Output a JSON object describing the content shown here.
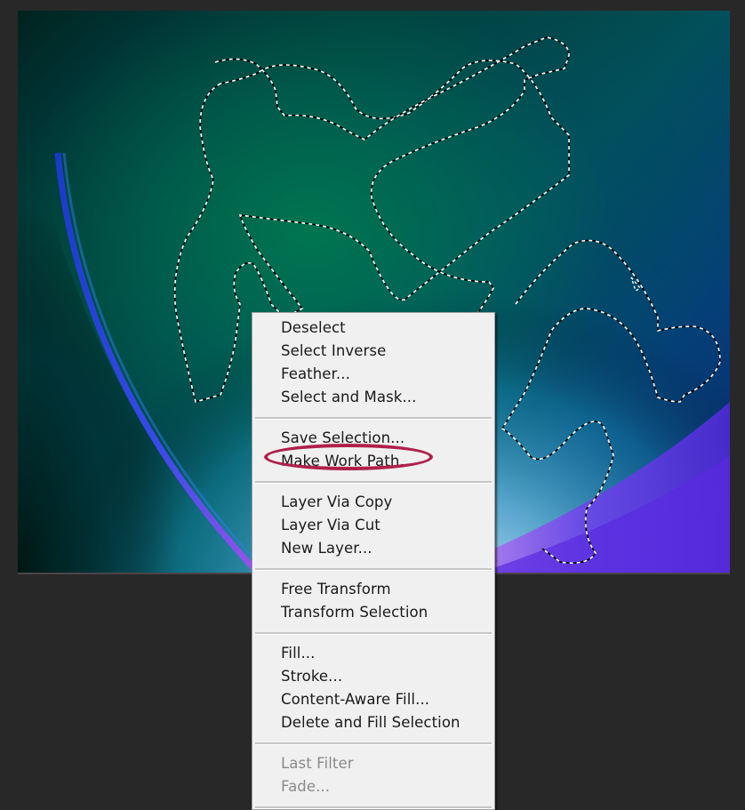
{
  "canvas": {
    "description": "Photo canvas with green-blue glowing planet edge and marching-ants selection around two figure silhouettes",
    "selection_active": true
  },
  "context_menu": {
    "groups": [
      {
        "items": [
          {
            "label": "Deselect",
            "enabled": true
          },
          {
            "label": "Select Inverse",
            "enabled": true
          },
          {
            "label": "Feather...",
            "enabled": true
          },
          {
            "label": "Select and Mask...",
            "enabled": true
          }
        ]
      },
      {
        "items": [
          {
            "label": "Save Selection...",
            "enabled": true
          },
          {
            "label": "Make Work Path...",
            "enabled": true,
            "highlighted": true
          }
        ]
      },
      {
        "items": [
          {
            "label": "Layer Via Copy",
            "enabled": true
          },
          {
            "label": "Layer Via Cut",
            "enabled": true
          },
          {
            "label": "New Layer...",
            "enabled": true
          }
        ]
      },
      {
        "items": [
          {
            "label": "Free Transform",
            "enabled": true
          },
          {
            "label": "Transform Selection",
            "enabled": true
          }
        ]
      },
      {
        "items": [
          {
            "label": "Fill...",
            "enabled": true
          },
          {
            "label": "Stroke...",
            "enabled": true
          },
          {
            "label": "Content-Aware Fill...",
            "enabled": true
          },
          {
            "label": "Delete and Fill Selection",
            "enabled": true
          }
        ]
      },
      {
        "items": [
          {
            "label": "Last Filter",
            "enabled": false
          },
          {
            "label": "Fade...",
            "enabled": false
          }
        ]
      }
    ]
  },
  "annotation": {
    "highlight_color": "#b0204a",
    "target": "Make Work Path..."
  },
  "colors": {
    "workspace_bg": "#282828",
    "menu_bg": "#f0f0f0",
    "menu_text": "#1a1a1a",
    "menu_disabled_text": "#8a8a8a"
  }
}
